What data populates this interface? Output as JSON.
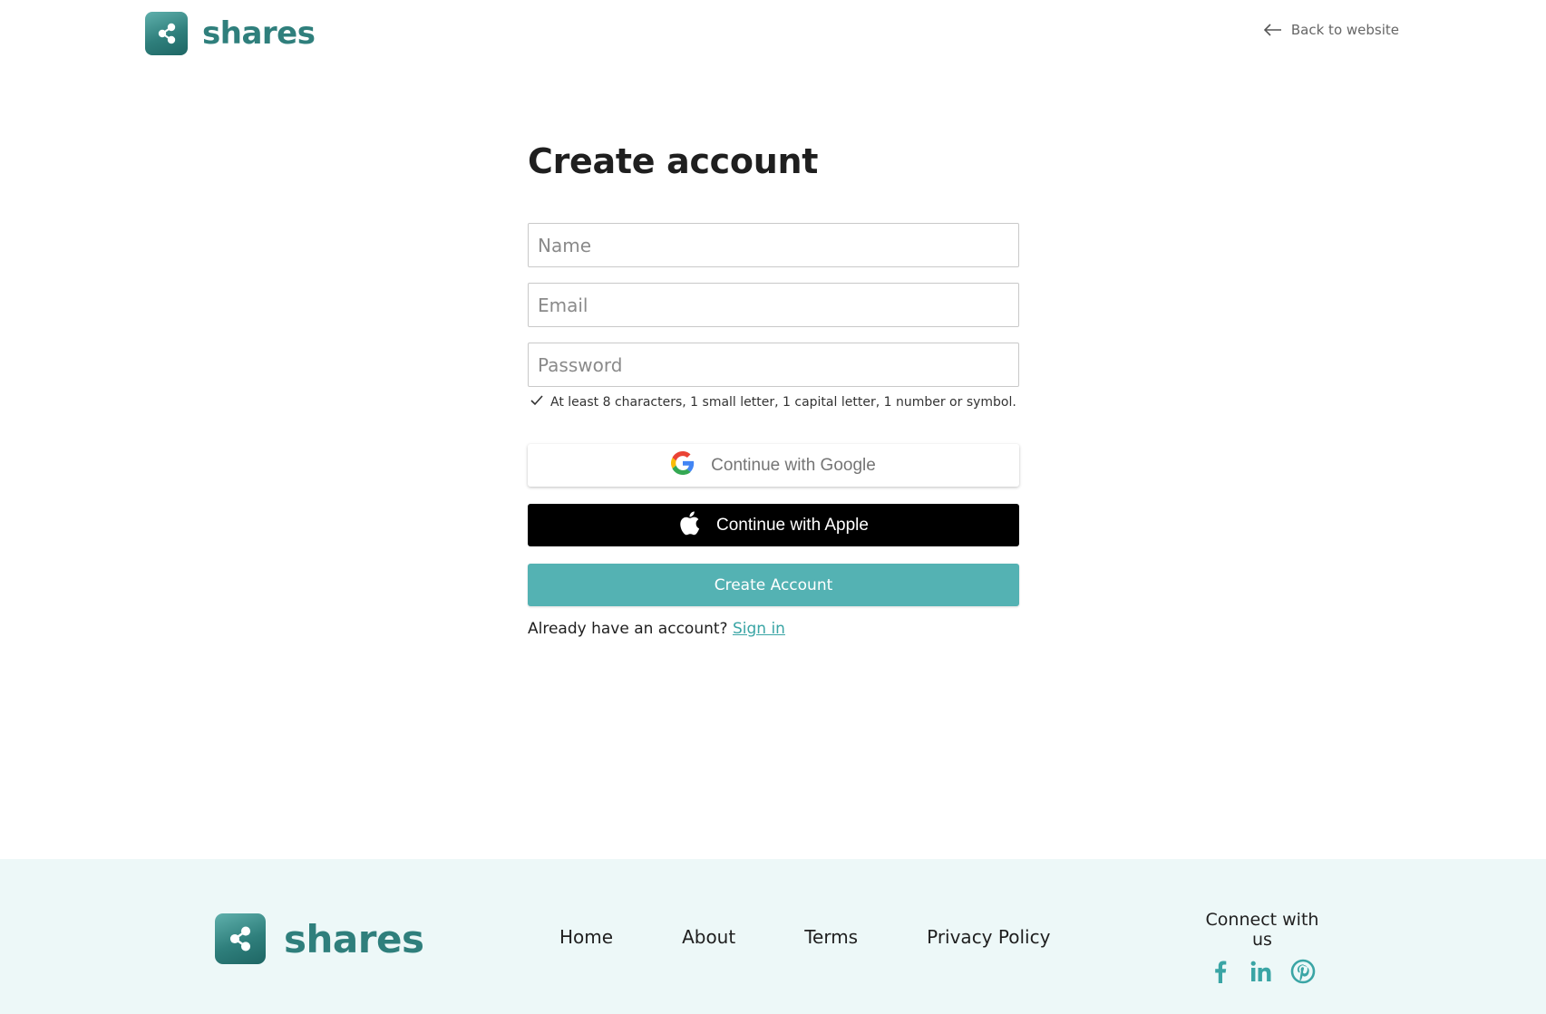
{
  "brand": {
    "name": "shares",
    "color": "#2f7f7c",
    "accent": "#54b2b3"
  },
  "header": {
    "back_link": "Back to website"
  },
  "form": {
    "title": "Create account",
    "name_placeholder": "Name",
    "email_placeholder": "Email",
    "password_placeholder": "Password",
    "password_hint": "At least 8 characters, 1 small letter, 1 capital letter, 1 number or symbol.",
    "google_button": "Continue with Google",
    "apple_button": "Continue with Apple",
    "create_button": "Create Account",
    "signin_prompt": "Already have an account?",
    "signin_link": "Sign in"
  },
  "footer": {
    "nav": [
      "Home",
      "About",
      "Terms",
      "Privacy Policy"
    ],
    "connect_title": "Connect with us",
    "socials": [
      "facebook-icon",
      "linkedin-icon",
      "pinterest-icon"
    ]
  }
}
